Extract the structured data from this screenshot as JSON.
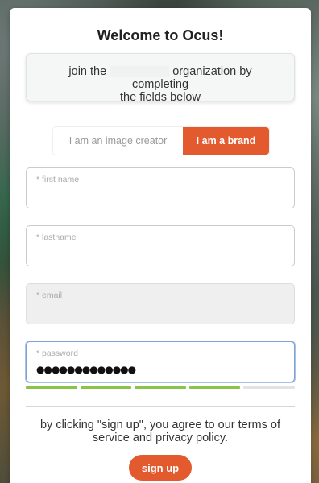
{
  "title": "Welcome to Ocus!",
  "info": {
    "prefix": "join the",
    "suffix": "organization by completing",
    "line2": "the fields below"
  },
  "role_toggle": {
    "creator_label": "I am an image creator",
    "brand_label": "I am a brand",
    "selected": "I am a brand"
  },
  "form": {
    "first_name": {
      "label": "* first name",
      "value": ""
    },
    "last_name": {
      "label": "* lastname",
      "value": ""
    },
    "email": {
      "label": "* email",
      "value": ""
    },
    "password": {
      "label": "* password",
      "value": "●●●●●●●●●●●●●"
    }
  },
  "password_strength": {
    "filled_segments": 4,
    "total_segments": 5
  },
  "terms_text": "by clicking \"sign up\", you agree to our terms of service and privacy policy.",
  "signup_label": "sign up",
  "colors": {
    "accent": "#e45a2f",
    "strength": "#8bc34a"
  }
}
